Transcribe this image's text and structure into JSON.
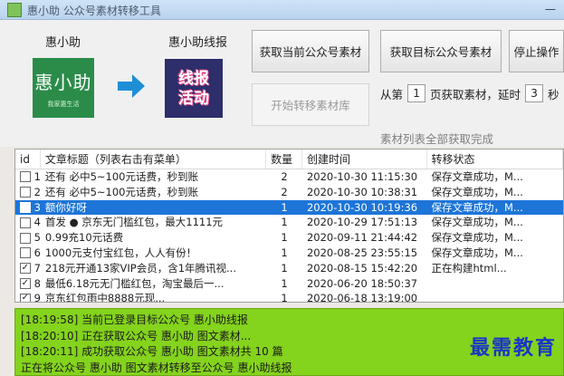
{
  "window": {
    "title": "惠小助  公众号素材转移工具"
  },
  "source": {
    "name": "惠小助",
    "logo_text": "惠小助",
    "logo_sub": "我家惠生活"
  },
  "target": {
    "name": "惠小助线报",
    "logo_line1": "线报",
    "logo_line2": "活动"
  },
  "buttons": {
    "fetch_current": "获取当前公众号素材",
    "fetch_target": "获取目标公众号素材",
    "stop": "停止操作",
    "start_transfer": "开始转移素材库"
  },
  "range": {
    "from_label": "从第",
    "from_value": "1",
    "page_label": "页获取素材，延时",
    "delay_value": "3",
    "unit": "秒"
  },
  "status_note": "素材列表全部获取完成",
  "table": {
    "headers": [
      "id",
      "文章标题（列表右击有菜单）",
      "数量",
      "创建时间",
      "转移状态"
    ],
    "rows": [
      {
        "id": "1",
        "checked": false,
        "title": "还有   必中5~100元话费，秒到账",
        "count": "2",
        "time": "2020-10-30 11:15:30",
        "status": "保存文章成功，M...",
        "selected": false
      },
      {
        "id": "2",
        "checked": false,
        "title": "还有   必中5~100元话费，秒到账",
        "count": "2",
        "time": "2020-10-30 10:38:31",
        "status": "保存文章成功，M...",
        "selected": false
      },
      {
        "id": "3",
        "checked": false,
        "title": "额你好呀",
        "count": "1",
        "time": "2020-10-30 10:19:36",
        "status": "保存文章成功，M...",
        "selected": true
      },
      {
        "id": "4",
        "checked": false,
        "title": "首发 ● 京东无门槛红包，最大1111元",
        "count": "1",
        "time": "2020-10-29 17:51:13",
        "status": "保存文章成功，M...",
        "selected": false
      },
      {
        "id": "5",
        "checked": false,
        "title": "0.99充10元话费",
        "count": "1",
        "time": "2020-09-11 21:44:42",
        "status": "保存文章成功，M...",
        "selected": false
      },
      {
        "id": "6",
        "checked": false,
        "title": "1000元支付宝红包，人人有份！",
        "count": "1",
        "time": "2020-08-25 23:55:15",
        "status": "保存文章成功，M...",
        "selected": false
      },
      {
        "id": "7",
        "checked": true,
        "title": "218元开通13家VIP会员，含1年腾讯视...",
        "count": "1",
        "time": "2020-08-15 15:42:20",
        "status": "正在构建html...",
        "selected": false
      },
      {
        "id": "8",
        "checked": true,
        "title": "最低6.18元无门槛红包，淘宝最后一...",
        "count": "1",
        "time": "2020-06-20 18:50:37",
        "status": "",
        "selected": false
      },
      {
        "id": "9",
        "checked": true,
        "title": "京东红包雨中8888元现...",
        "count": "1",
        "time": "2020-06-18 13:19:00",
        "status": "",
        "selected": false
      }
    ]
  },
  "log": [
    "[18:19:58] 当前已登录目标公众号 惠小助线报",
    "[18:20:10] 正在获取公众号 惠小助 图文素材...",
    "[18:20:11] 成功获取公众号 惠小助 图文素材共 10 篇",
    "正在将公众号 惠小助 图文素材转移至公众号 惠小助线报"
  ],
  "watermark": "最需教育"
}
